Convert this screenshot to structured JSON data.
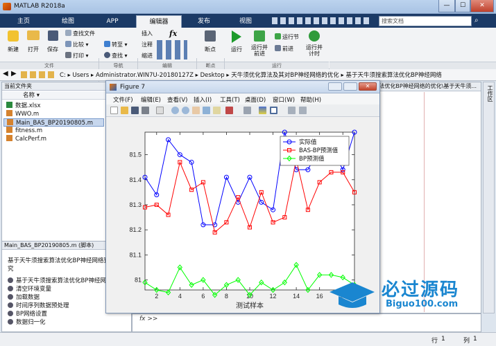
{
  "app": {
    "title": "MATLAB R2018a",
    "ctl_min": "—",
    "ctl_max": "☐",
    "ctl_close": "✕"
  },
  "tabs": [
    "主页",
    "绘图",
    "APP",
    "编辑器",
    "发布",
    "视图"
  ],
  "search_placeholder": "搜索文档",
  "ribbon": {
    "file_group": "文件",
    "nav_group": "导航",
    "edit_group": "编辑",
    "breakpoint_group": "断点",
    "run_group": "运行",
    "new": "新建",
    "open": "打开",
    "save": "保存",
    "find_files": "查找文件",
    "compare": "比较",
    "print": "打印",
    "goto": "转至",
    "find": "查找",
    "insert": "插入",
    "comment": "注释",
    "indent": "缩进",
    "fx": "fx",
    "breakpoints": "断点",
    "run": "运行",
    "run_advance": "运行并前进",
    "run_section": "运行节",
    "advance": "前进",
    "run_time": "运行并计时"
  },
  "path": [
    "C:",
    "Users",
    "Administrator.WIN7U-20180127Z",
    "Desktop",
    "天牛须优化算法及其对BP神经网络的优化",
    "基于天牛须搜索算法优化BP神经网络"
  ],
  "current_folder": {
    "header": "当前文件夹",
    "name_col": "名称",
    "files": [
      "数据.xlsx",
      "WWO.m",
      "Main_BAS_BP20190805.m",
      "fitness.m",
      "CalcPerf.m"
    ]
  },
  "details": {
    "header": "Main_BAS_BP20190805.m  (脚本)",
    "title_text": "基于天牛须搜索算法优化BP神经网络预测",
    "title_text2": "究",
    "items": [
      "基于天牛须搜索算法优化BP神经网络",
      "清空环境变量",
      "加载数据",
      "时间序列数据预处理",
      "BP网络设置",
      "数据归一化"
    ]
  },
  "editor": {
    "tab_text": "基于天牛须搜索算法优化BP神经网络的优化\\基于天牛须..."
  },
  "workspace_label": "工作区",
  "command": {
    "prompt": "fx >>"
  },
  "status": {
    "row_label": "行",
    "row_value": "1",
    "col_label": "列",
    "col_value": "1"
  },
  "figure": {
    "title": "Figure 7",
    "menu": [
      "文件(F)",
      "编辑(E)",
      "查看(V)",
      "插入(I)",
      "工具(T)",
      "桌面(D)",
      "窗口(W)",
      "帮助(H)"
    ]
  },
  "watermark": {
    "text": "必过源码",
    "url": "Biguo100.com"
  },
  "colors": {
    "actual": "#0000ff",
    "bas_bp": "#ff0000",
    "bp": "#00ff00",
    "tabbar": "#1b3a66"
  },
  "chart_data": {
    "type": "line",
    "xlabel": "测试样本",
    "ylabel": "",
    "x": [
      1,
      2,
      3,
      4,
      5,
      6,
      7,
      8,
      9,
      10,
      11,
      12,
      13,
      14,
      15,
      16,
      17,
      18,
      19
    ],
    "xticks": [
      2,
      4,
      6,
      8,
      10,
      12,
      14,
      16,
      18
    ],
    "yticks": [
      81,
      81.1,
      81.2,
      81.3,
      81.4,
      81.5
    ],
    "xlim": [
      1,
      19
    ],
    "ylim": [
      80.96,
      81.59
    ],
    "grid": false,
    "legend_position": "top-right",
    "series": [
      {
        "name": "实际值",
        "color": "#0000ff",
        "marker": "circle",
        "values": [
          81.41,
          81.34,
          81.56,
          81.5,
          81.47,
          81.22,
          81.22,
          81.41,
          81.31,
          81.41,
          81.31,
          81.28,
          81.59,
          81.44,
          81.44,
          81.53,
          81.53,
          81.44,
          81.59
        ]
      },
      {
        "name": "BAS-BP预测值",
        "color": "#ff0000",
        "marker": "square",
        "values": [
          81.29,
          81.3,
          81.26,
          81.47,
          81.36,
          81.39,
          81.19,
          81.23,
          81.33,
          81.21,
          81.35,
          81.23,
          81.25,
          81.48,
          81.28,
          81.39,
          81.43,
          81.43,
          81.35
        ]
      },
      {
        "name": "BP预测值",
        "color": "#00ff00",
        "marker": "diamond",
        "values": [
          80.99,
          80.96,
          80.95,
          81.05,
          80.98,
          81.0,
          80.94,
          80.98,
          81.0,
          80.94,
          80.99,
          80.96,
          80.99,
          81.06,
          80.96,
          81.02,
          81.02,
          81.01,
          80.98
        ]
      }
    ]
  }
}
